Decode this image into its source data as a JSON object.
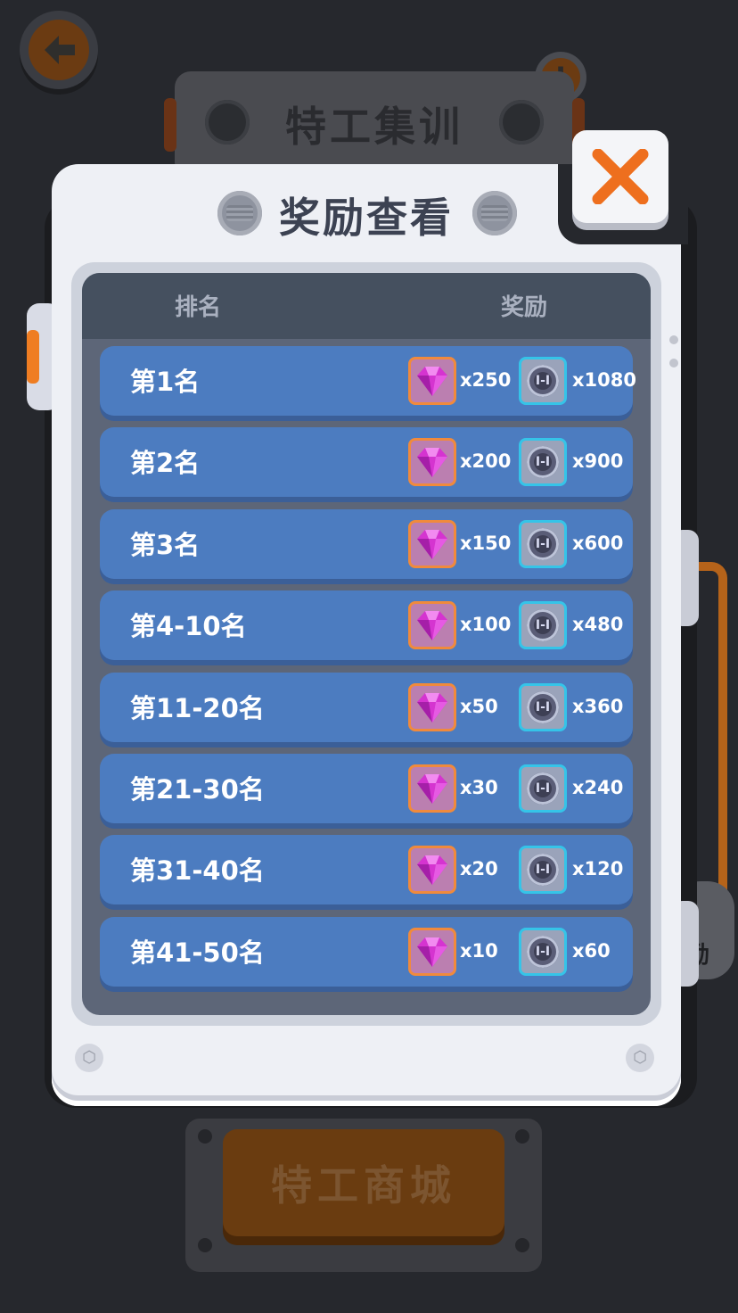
{
  "background": {
    "screen_title": "特工集训",
    "shop_button_label": "特工商城",
    "side_label": "励",
    "alert_symbol": "!"
  },
  "modal": {
    "title": "奖励查看",
    "close_symbol": "✕",
    "columns": {
      "rank": "排名",
      "reward": "奖励"
    },
    "rows": [
      {
        "rank": "第1名",
        "gems": "x250",
        "coins": "x1080"
      },
      {
        "rank": "第2名",
        "gems": "x200",
        "coins": "x900"
      },
      {
        "rank": "第3名",
        "gems": "x150",
        "coins": "x600"
      },
      {
        "rank": "第4-10名",
        "gems": "x100",
        "coins": "x480"
      },
      {
        "rank": "第11-20名",
        "gems": "x50",
        "coins": "x360"
      },
      {
        "rank": "第21-30名",
        "gems": "x30",
        "coins": "x240"
      },
      {
        "rank": "第31-40名",
        "gems": "x20",
        "coins": "x120"
      },
      {
        "rank": "第41-50名",
        "gems": "x10",
        "coins": "x60"
      }
    ]
  },
  "colors": {
    "row_blue": "#4c7cc0",
    "accent_orange": "#ef7d22",
    "gem_frame": "#f08a3c",
    "coin_frame": "#35c4e8"
  },
  "icons": {
    "back": "back-arrow-icon",
    "alert": "alert-icon",
    "close": "close-icon",
    "gem": "gem-icon",
    "coin": "token-coin-icon"
  }
}
